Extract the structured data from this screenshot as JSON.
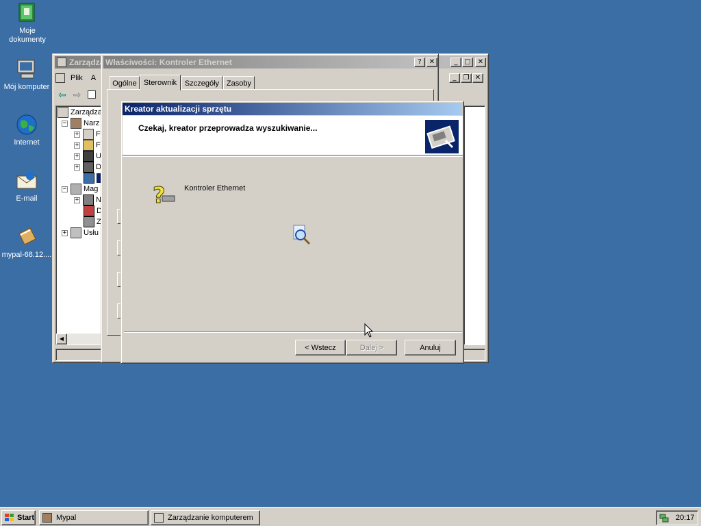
{
  "desktop": {
    "icons": [
      {
        "label": "Moje dokumenty",
        "icon": "my-documents-icon"
      },
      {
        "label": "Mój komputer",
        "icon": "my-computer-icon"
      },
      {
        "label": "Internet",
        "icon": "internet-globe-icon"
      },
      {
        "label": "E-mail",
        "icon": "email-icon"
      },
      {
        "label": "mypal-68.12....",
        "icon": "mypal-archive-icon"
      }
    ]
  },
  "mmc": {
    "title": "Zarządza",
    "menu": {
      "file": "Plik",
      "action": "A"
    },
    "tree": [
      {
        "label": "Zarządza",
        "icon": "computer-management-icon"
      },
      {
        "label": "Narz",
        "icon": "system-tools-icon"
      },
      {
        "label": "F",
        "icon": "event-viewer-icon"
      },
      {
        "label": "F",
        "icon": "system-info-icon"
      },
      {
        "label": "U",
        "icon": "users-icon"
      },
      {
        "label": "D",
        "icon": "device-manager-icon"
      },
      {
        "label": "",
        "icon": "network-device-icon"
      },
      {
        "label": "Mag",
        "icon": "storage-icon"
      },
      {
        "label": "N",
        "icon": "removable-storage-icon"
      },
      {
        "label": "D",
        "icon": "disk-defrag-icon"
      },
      {
        "label": "Z",
        "icon": "disk-management-icon"
      },
      {
        "label": "Usłu",
        "icon": "services-icon"
      }
    ]
  },
  "properties": {
    "title": "Właściwości: Kontroler Ethernet",
    "tabs": [
      "Ogólne",
      "Sterownik",
      "Szczegóły",
      "Zasoby"
    ],
    "active_tab": "Sterownik"
  },
  "wizard": {
    "title": "Kreator aktualizacji sprzętu",
    "header_text": "Czekaj, kreator przeprowadza wyszukiwanie...",
    "device_name": "Kontroler Ethernet",
    "buttons": {
      "back": "< Wstecz",
      "next": "Dalej >",
      "cancel": "Anuluj"
    }
  },
  "taskbar": {
    "start": "Start",
    "tasks": [
      {
        "label": "Mypal",
        "icon": "mypal-icon"
      },
      {
        "label": "Zarządzanie komputerem",
        "icon": "computer-management-icon"
      }
    ],
    "clock": "20:17"
  }
}
